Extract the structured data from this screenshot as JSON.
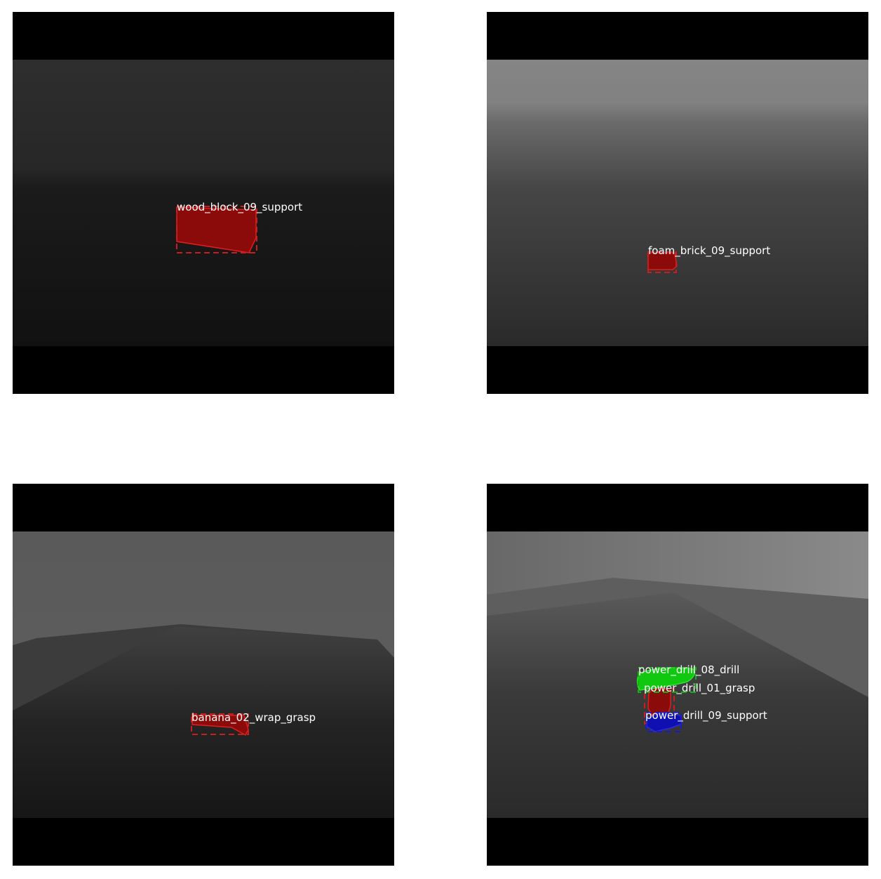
{
  "panels": [
    {
      "labels": [
        "wood_block_09_support"
      ]
    },
    {
      "labels": [
        "foam_brick_09_support"
      ]
    },
    {
      "labels": [
        "banana_02_wrap_grasp"
      ]
    },
    {
      "labels": [
        "power_drill_08_drill",
        "power_drill_01_grasp",
        "power_drill_09_support"
      ]
    }
  ],
  "colors": {
    "mask_red": "#8b0a0a",
    "mask_green": "#11c811",
    "mask_blue": "#1010b0",
    "box_red": "#c81e1e",
    "box_green": "#12b012",
    "box_blue": "#1a1ac8",
    "label_text": "#ffffff"
  }
}
